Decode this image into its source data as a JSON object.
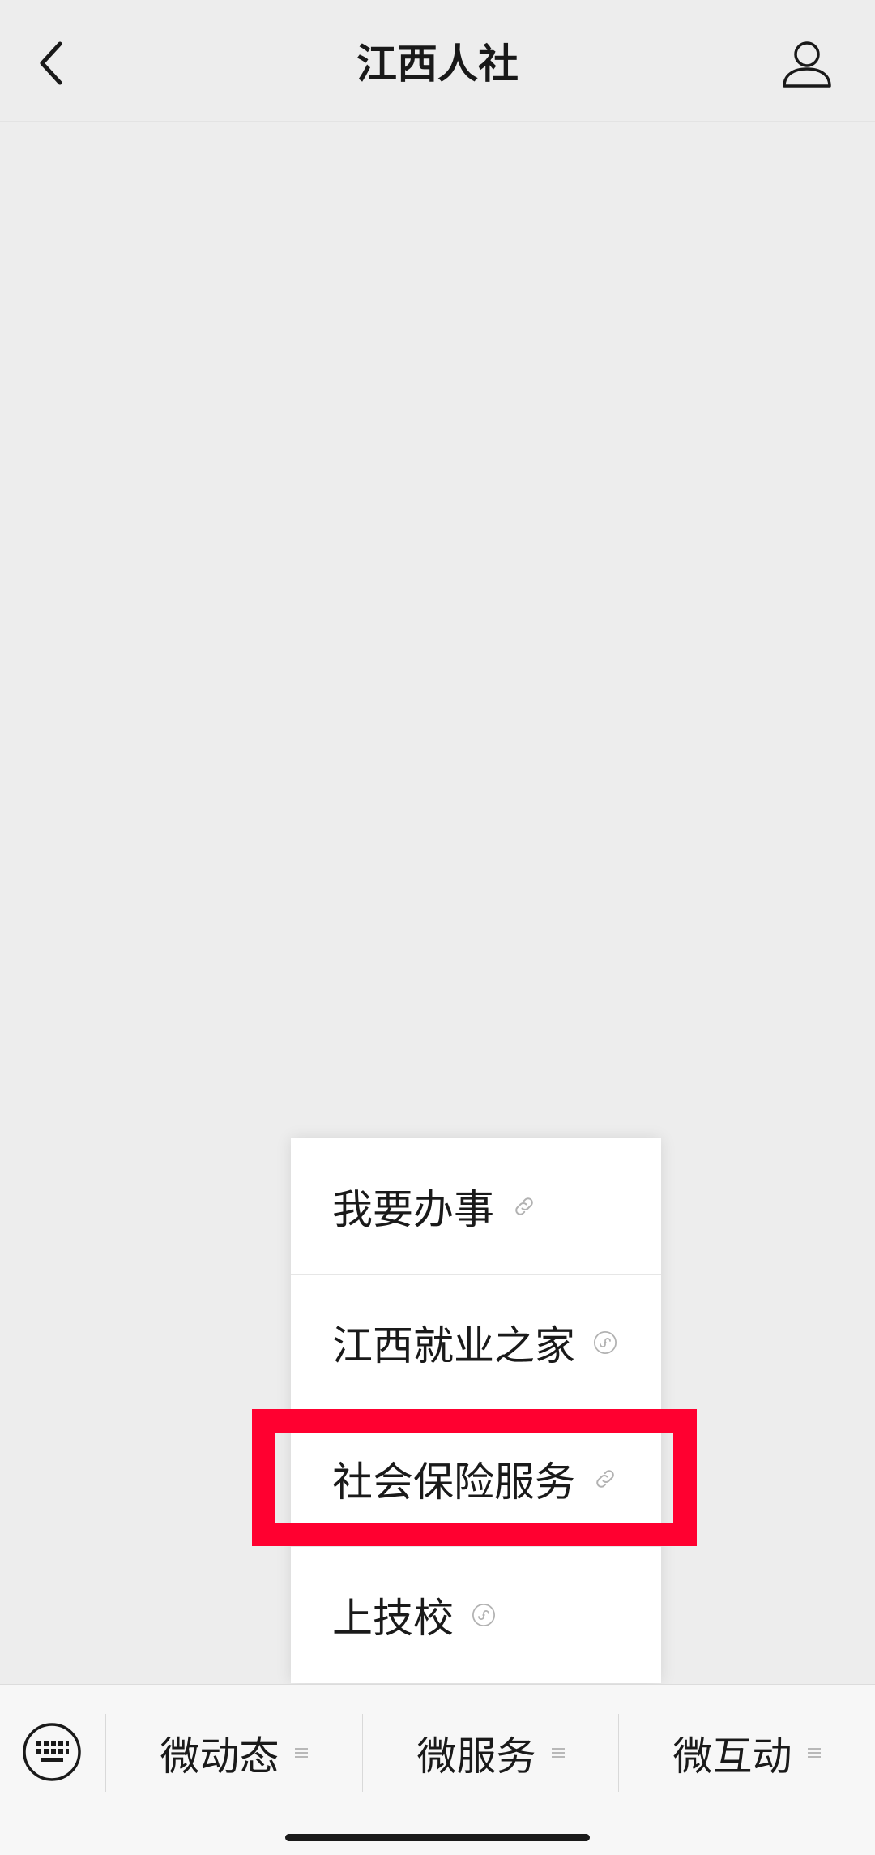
{
  "nav": {
    "title": "江西人社",
    "back_icon": "chevron-left-icon",
    "profile_icon": "user-icon"
  },
  "menu": {
    "items": [
      {
        "label": "我要办事",
        "icon": "link-icon"
      },
      {
        "label": "江西就业之家",
        "icon": "mini-program-icon"
      },
      {
        "label": "社会保险服务",
        "icon": "link-icon"
      },
      {
        "label": "上技校",
        "icon": "mini-program-icon"
      }
    ]
  },
  "bottom_bar": {
    "keyboard_icon": "keyboard-icon",
    "tabs": [
      {
        "label": "微动态",
        "icon": "menu-lines-icon"
      },
      {
        "label": "微服务",
        "icon": "menu-lines-icon"
      },
      {
        "label": "微互动",
        "icon": "menu-lines-icon"
      }
    ]
  },
  "colors": {
    "background": "#ededed",
    "menu_background": "#ffffff",
    "highlight": "#ff0030",
    "text": "#191919",
    "icon_gray": "#b2b2b2"
  }
}
